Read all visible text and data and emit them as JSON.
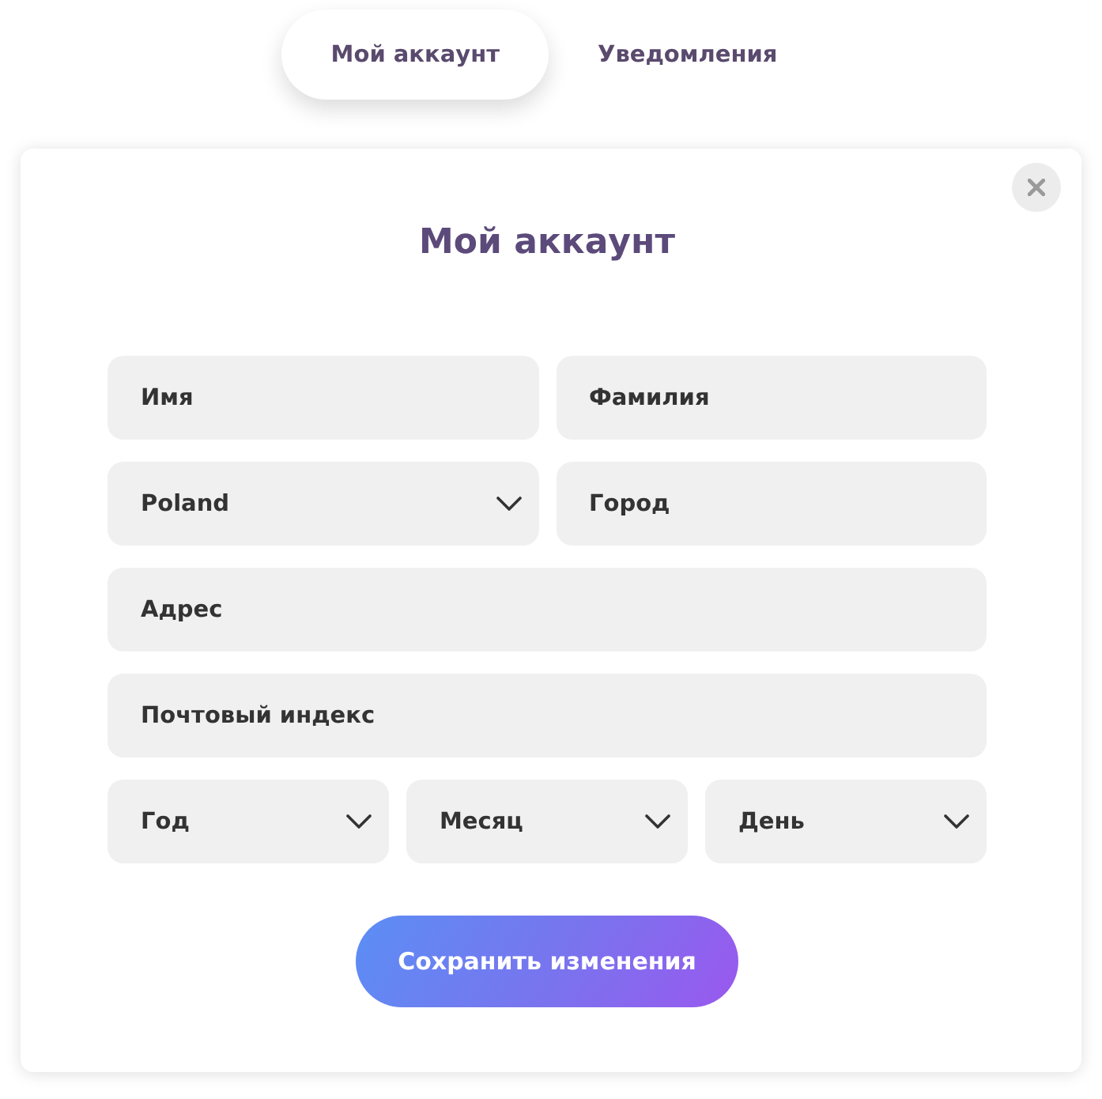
{
  "tabs": [
    {
      "label": "Мой аккаунт",
      "selected": true
    },
    {
      "label": "Уведомления",
      "selected": false
    }
  ],
  "dialog": {
    "title": "Мой аккаунт",
    "form_rows": [
      {
        "fields": [
          {
            "kind": "input",
            "placeholder": "Имя"
          },
          {
            "kind": "input",
            "placeholder": "Фамилия"
          }
        ]
      },
      {
        "fields": [
          {
            "kind": "select",
            "value": "Poland"
          },
          {
            "kind": "input",
            "placeholder": "Город"
          }
        ]
      },
      {
        "fields": [
          {
            "kind": "input",
            "placeholder": "Адрес"
          }
        ]
      },
      {
        "fields": [
          {
            "kind": "input",
            "placeholder": "Почтовый индекс"
          }
        ]
      },
      {
        "fields": [
          {
            "kind": "select",
            "value": "Год"
          },
          {
            "kind": "select",
            "value": "Месяц"
          },
          {
            "kind": "select",
            "value": "День"
          }
        ]
      }
    ],
    "save_button": {
      "label": "Сохранить изменения"
    }
  }
}
